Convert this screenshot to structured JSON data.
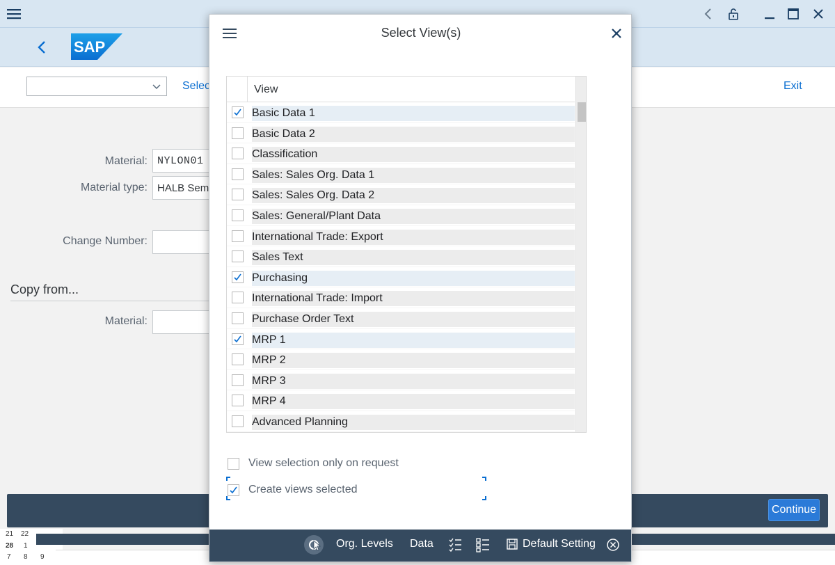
{
  "window": {
    "menu_icon": "hamburger-icon",
    "controls": [
      "back-icon",
      "lock-icon",
      "minimize-icon",
      "maximize-icon",
      "close-icon"
    ]
  },
  "header": {
    "logo": "SAP",
    "back_icon": "chevron-left-icon"
  },
  "toolbar": {
    "select_value": "",
    "select_link": "Selec",
    "exit_label": "Exit"
  },
  "form": {
    "material_label": "Material:",
    "material_value": "NYLON01",
    "material_type_label": "Material type:",
    "material_type_value": "HALB Sem",
    "change_number_label": "Change Number:",
    "change_number_value": "",
    "copy_from_title": "Copy from...",
    "copy_material_label": "Material:",
    "copy_material_value": ""
  },
  "bottom": {
    "continue_label": "Continue",
    "calendar": [
      "21",
      "22",
      "28",
      "1",
      "7",
      "8",
      "9"
    ]
  },
  "dialog": {
    "title": "Select View(s)",
    "column_header": "View",
    "views": [
      {
        "label": "Basic Data 1",
        "checked": true
      },
      {
        "label": "Basic Data 2",
        "checked": false
      },
      {
        "label": "Classification",
        "checked": false
      },
      {
        "label": "Sales: Sales Org. Data 1",
        "checked": false
      },
      {
        "label": "Sales: Sales Org. Data 2",
        "checked": false
      },
      {
        "label": "Sales: General/Plant Data",
        "checked": false
      },
      {
        "label": "International Trade: Export",
        "checked": false
      },
      {
        "label": "Sales Text",
        "checked": false
      },
      {
        "label": "Purchasing",
        "checked": true
      },
      {
        "label": "International Trade: Import",
        "checked": false
      },
      {
        "label": "Purchase Order Text",
        "checked": false
      },
      {
        "label": "MRP 1",
        "checked": true
      },
      {
        "label": "MRP 2",
        "checked": false
      },
      {
        "label": "MRP 3",
        "checked": false
      },
      {
        "label": "MRP 4",
        "checked": false
      },
      {
        "label": "Advanced Planning",
        "checked": false
      }
    ],
    "option_request_label": "View selection only on request",
    "option_request_checked": false,
    "option_create_label": "Create views selected",
    "option_create_checked": true,
    "footer": {
      "org_levels": "Org. Levels",
      "data": "Data",
      "default_setting": "Default Setting"
    }
  },
  "colors": {
    "shell_header": "#d8e6f2",
    "footer_dark": "#354a5f",
    "accent": "#0a6ed1",
    "continue_button": "#2b7ad8"
  }
}
